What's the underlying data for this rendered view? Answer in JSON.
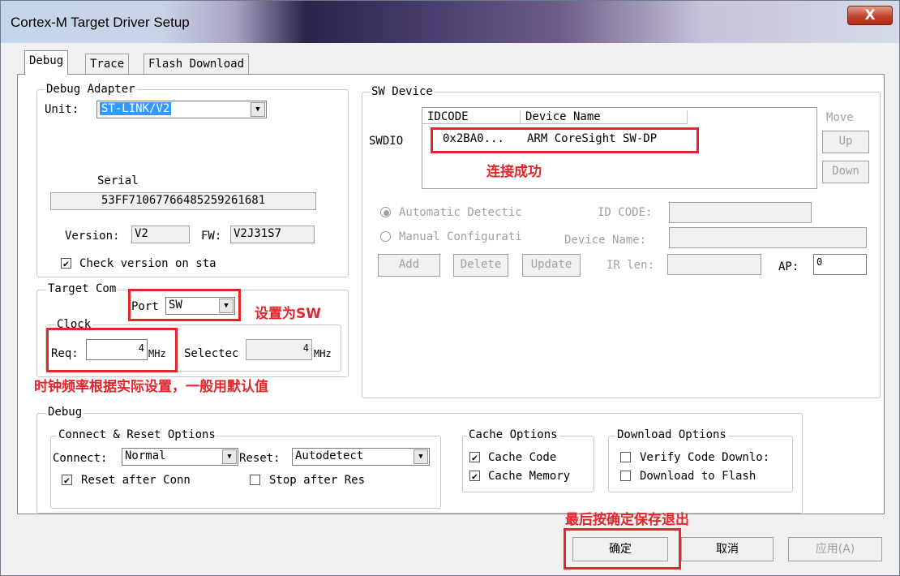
{
  "window": {
    "title": "Cortex-M Target Driver Setup",
    "close": "X"
  },
  "tabs": [
    "Debug",
    "Trace",
    "Flash Download"
  ],
  "debug_adapter": {
    "legend": "Debug Adapter",
    "unit_label": "Unit:",
    "unit_value": "ST-LINK/V2",
    "serial_label": "Serial",
    "serial_value": "53FF71067766485259261681",
    "version_label": "Version:",
    "version_value": "V2",
    "fw_label": "FW:",
    "fw_value": "V2J31S7",
    "check_version_label": "Check version on sta",
    "check_version_checked": true
  },
  "target_com": {
    "legend": "Target Com",
    "port_label": "Port",
    "port_value": "SW",
    "clock_legend": "Clock",
    "req_label": "Req:",
    "req_value": "4",
    "mhz": "MHz",
    "selected_label": "Selectec",
    "selected_value": "4"
  },
  "sw_device": {
    "legend": "SW Device",
    "swdio_label": "SWDIO",
    "columns": [
      "IDCODE",
      "Device Name"
    ],
    "rows": [
      {
        "idcode": "0x2BA0...",
        "device_name": "ARM CoreSight SW-DP"
      }
    ],
    "move_label": "Move",
    "up_label": "Up",
    "down_label": "Down",
    "auto_detect_label": "Automatic Detectic",
    "manual_config_label": "Manual Configurati",
    "id_code_label": "ID CODE:",
    "device_name_label": "Device Name:",
    "add_label": "Add",
    "delete_label": "Delete",
    "update_label": "Update",
    "ir_len_label": "IR len:",
    "ap_label": "AP:",
    "ap_value": "0"
  },
  "debug_section": {
    "legend": "Debug",
    "connect_reset_legend": "Connect & Reset Options",
    "connect_label": "Connect:",
    "connect_value": "Normal",
    "reset_label": "Reset:",
    "reset_value": "Autodetect",
    "reset_after_connect_label": "Reset after Conn",
    "reset_after_connect_checked": true,
    "stop_after_reset_label": "Stop after Res",
    "stop_after_reset_checked": false,
    "cache_legend": "Cache Options",
    "cache_code_label": "Cache Code",
    "cache_code_checked": true,
    "cache_memory_label": "Cache Memory",
    "cache_memory_checked": true,
    "download_legend": "Download Options",
    "verify_label": "Verify Code Downlo:",
    "verify_checked": false,
    "download_flash_label": "Download to Flash",
    "download_flash_checked": false
  },
  "buttons": {
    "ok": "确定",
    "cancel": "取消",
    "apply": "应用(A)"
  },
  "annotations": {
    "connected": "连接成功",
    "set_sw": "设置为SW",
    "clock_note": "时钟频率根据实际设置，一般用默认值",
    "save_note": "最后按确定保存退出"
  },
  "colors": {
    "annotation": "#e3262b",
    "selection": "#3399ff"
  }
}
